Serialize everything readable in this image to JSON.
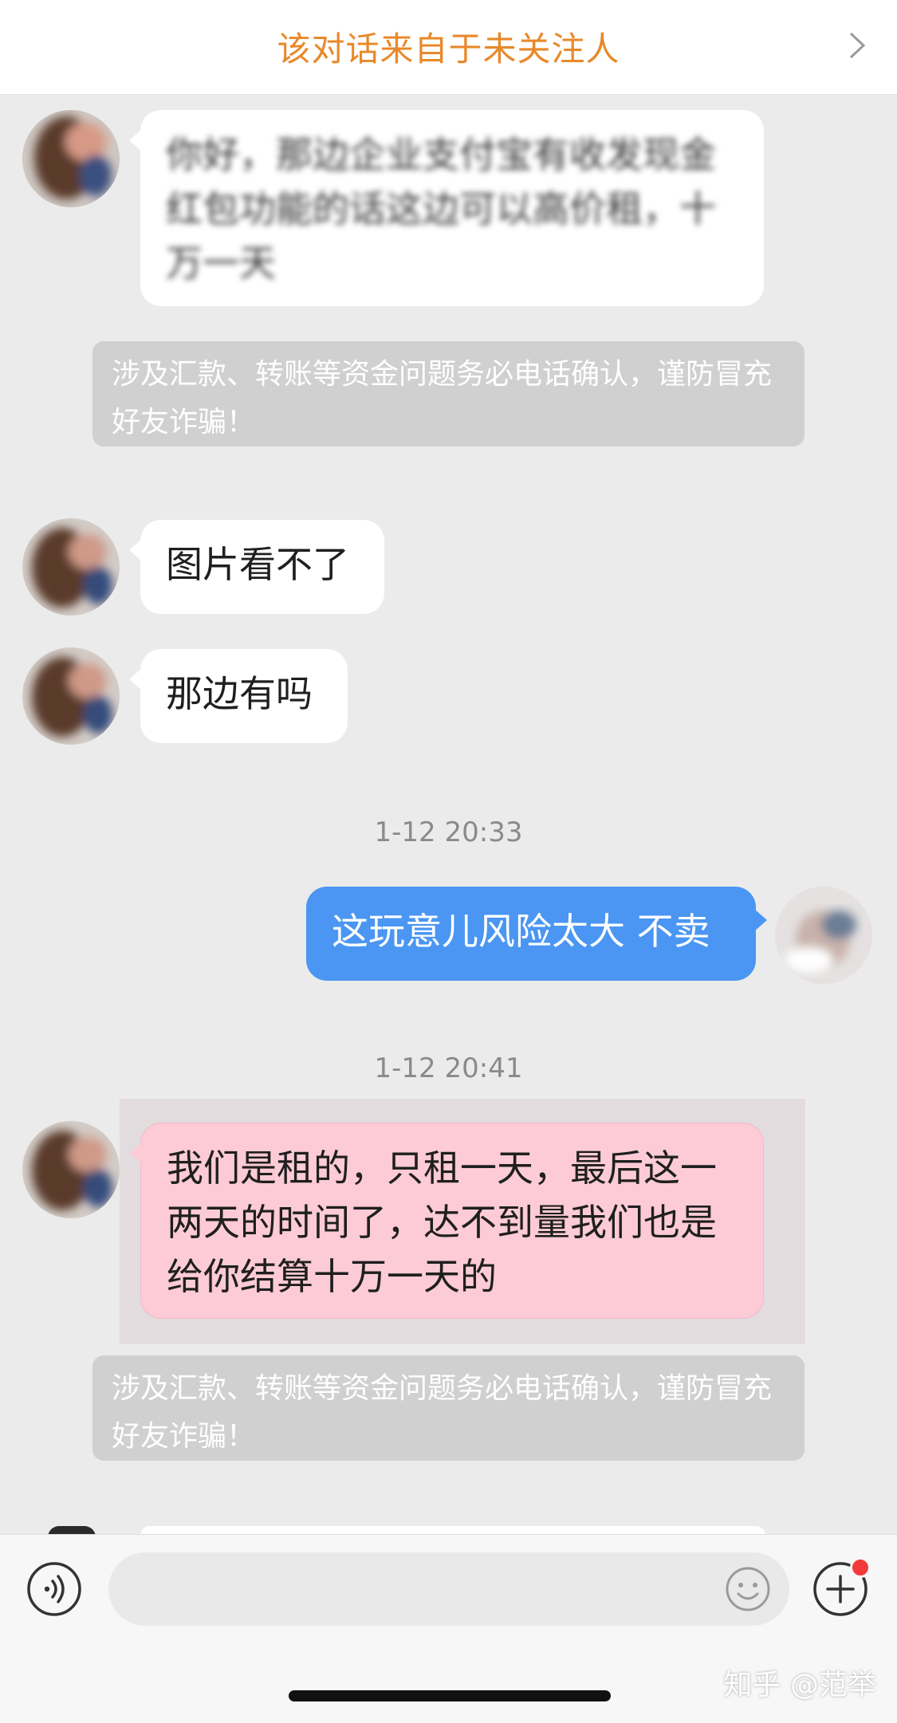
{
  "header": {
    "title": "该对话来自于未关注人"
  },
  "messages": [
    {
      "side": "left",
      "text": "你好，那边企业支付宝有收发现金红包功能的话这边可以高价租，十万一天",
      "blurred": true
    },
    {
      "type": "warning",
      "text": "涉及汇款、转账等资金问题务必电话确认，谨防冒充好友诈骗！"
    },
    {
      "side": "left",
      "text": "图片看不了"
    },
    {
      "side": "left",
      "text": "那边有吗"
    },
    {
      "type": "timestamp",
      "text": "1-12 20:33"
    },
    {
      "side": "right",
      "text": "这玩意儿风险太大 不卖"
    },
    {
      "type": "timestamp",
      "text": "1-12 20:41"
    },
    {
      "side": "left",
      "text": "我们是租的，只租一天，最后这一两天的时间了，达不到量我们也是给你结算十万一天的",
      "highlighted": true
    },
    {
      "type": "warning",
      "text": "涉及汇款、转账等资金问题务必电话确认，谨防冒充好友诈骗！"
    }
  ],
  "input": {
    "placeholder": ""
  },
  "watermark": "知乎 @范举",
  "icons": {
    "voice": "voice-icon",
    "emoji": "emoji-icon",
    "plus": "plus-icon",
    "chevron": "chevron-right-icon"
  },
  "colors": {
    "header_title": "#e8892a",
    "right_bubble": "#4a96f2",
    "highlight_bubble": "#fccbd6",
    "warning_bg": "#d0d0d0",
    "badge": "#f23a3a"
  }
}
